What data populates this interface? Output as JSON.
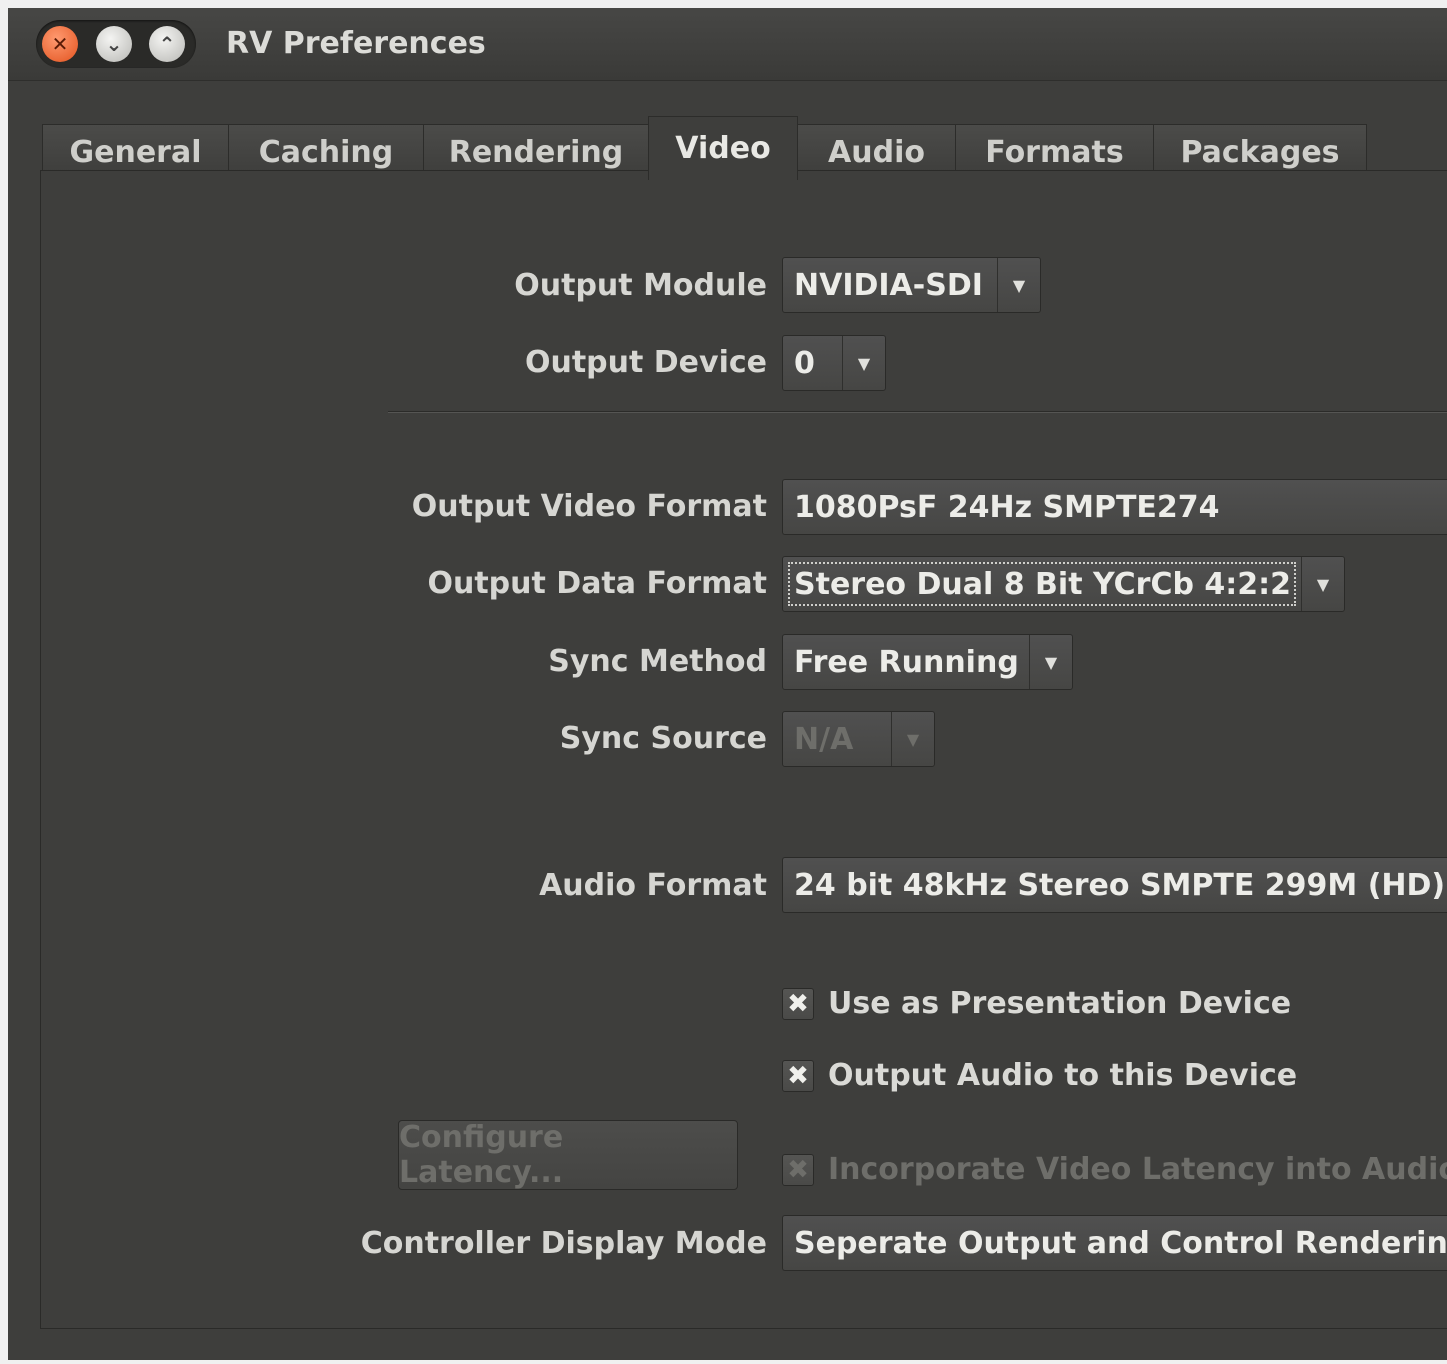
{
  "window": {
    "title": "RV Preferences",
    "controls": {
      "close_icon": "close-icon",
      "minimize_icon": "minimize-icon",
      "maximize_icon": "maximize-icon"
    }
  },
  "tabs": [
    {
      "label": "General"
    },
    {
      "label": "Caching"
    },
    {
      "label": "Rendering"
    },
    {
      "label": "Video",
      "active": true
    },
    {
      "label": "Audio"
    },
    {
      "label": "Formats"
    },
    {
      "label": "Packages"
    }
  ],
  "video": {
    "output_module": {
      "label": "Output Module",
      "value": "NVIDIA-SDI"
    },
    "output_device": {
      "label": "Output Device",
      "value": "0"
    },
    "output_video_format": {
      "label": "Output Video Format",
      "value": "1080PsF 24Hz SMPTE274"
    },
    "output_data_format": {
      "label": "Output Data Format",
      "value": "Stereo Dual 8 Bit YCrCb 4:2:2"
    },
    "sync_method": {
      "label": "Sync Method",
      "value": "Free Running"
    },
    "sync_source": {
      "label": "Sync Source",
      "value": "N/A",
      "disabled": true
    },
    "audio_format": {
      "label": "Audio Format",
      "value": "24 bit 48kHz Stereo SMPTE 299M (HD)"
    },
    "use_as_presentation": {
      "label": "Use as Presentation Device",
      "checked": true
    },
    "output_audio": {
      "label": "Output Audio to this Device",
      "checked": true
    },
    "configure_latency": {
      "label": "Configure Latency...",
      "disabled": true
    },
    "incorporate_latency": {
      "label": "Incorporate Video Latency into Audio Of",
      "checked": true,
      "disabled": true
    },
    "controller_display_mode": {
      "label": "Controller Display Mode",
      "value": "Seperate Output and Control Rendering"
    }
  }
}
